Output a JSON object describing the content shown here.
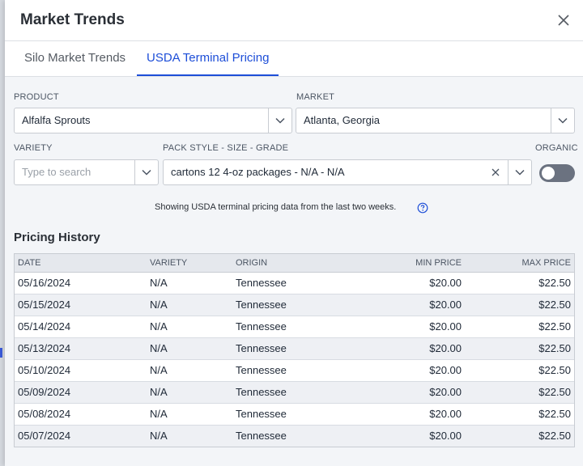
{
  "dialog": {
    "title": "Market Trends"
  },
  "tabs": [
    {
      "label": "Silo Market Trends",
      "active": false
    },
    {
      "label": "USDA Terminal Pricing",
      "active": true
    }
  ],
  "filters": {
    "product": {
      "label": "PRODUCT",
      "value": "Alfalfa Sprouts"
    },
    "market": {
      "label": "MARKET",
      "value": "Atlanta, Georgia"
    },
    "variety": {
      "label": "VARIETY",
      "placeholder": "Type to search"
    },
    "pack": {
      "label": "PACK STYLE - SIZE - GRADE",
      "value": "cartons 12 4-oz packages - N/A - N/A"
    },
    "organic": {
      "label": "ORGANIC",
      "enabled": false
    }
  },
  "info": {
    "text": "Showing USDA terminal pricing data from the last two weeks."
  },
  "history": {
    "title": "Pricing History",
    "columns": [
      "DATE",
      "VARIETY",
      "ORIGIN",
      "MIN PRICE",
      "MAX PRICE"
    ],
    "rows": [
      [
        "05/16/2024",
        "N/A",
        "Tennessee",
        "$20.00",
        "$22.50"
      ],
      [
        "05/15/2024",
        "N/A",
        "Tennessee",
        "$20.00",
        "$22.50"
      ],
      [
        "05/14/2024",
        "N/A",
        "Tennessee",
        "$20.00",
        "$22.50"
      ],
      [
        "05/13/2024",
        "N/A",
        "Tennessee",
        "$20.00",
        "$22.50"
      ],
      [
        "05/10/2024",
        "N/A",
        "Tennessee",
        "$20.00",
        "$22.50"
      ],
      [
        "05/09/2024",
        "N/A",
        "Tennessee",
        "$20.00",
        "$22.50"
      ],
      [
        "05/08/2024",
        "N/A",
        "Tennessee",
        "$20.00",
        "$22.50"
      ],
      [
        "05/07/2024",
        "N/A",
        "Tennessee",
        "$20.00",
        "$22.50"
      ]
    ]
  },
  "colors": {
    "accent": "#1d4ed8",
    "toggle_off": "#6b7280"
  }
}
